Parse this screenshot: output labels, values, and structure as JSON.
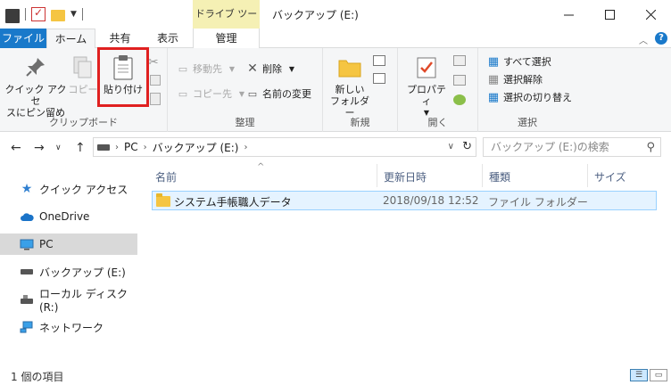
{
  "titlebar": {
    "context_tab": "ドライブ ツール",
    "window_title": "バックアップ (E:)"
  },
  "tabs": {
    "file": "ファイル",
    "home": "ホーム",
    "share": "共有",
    "view": "表示",
    "manage": "管理"
  },
  "ribbon": {
    "clipboard": {
      "pin": "クイック アクセ\nスにピン留め",
      "copy": "コピー",
      "paste": "貼り付け",
      "label": "クリップボード"
    },
    "organize": {
      "move_to": "移動先",
      "copy_to": "コピー先",
      "delete": "削除",
      "rename": "名前の変更",
      "label": "整理"
    },
    "new": {
      "new_folder": "新しい\nフォルダー",
      "label": "新規"
    },
    "open": {
      "properties": "プロパティ",
      "label": "開く"
    },
    "select": {
      "select_all": "すべて選択",
      "select_none": "選択解除",
      "invert": "選択の切り替え",
      "label": "選択"
    }
  },
  "address": {
    "crumbs": [
      "PC",
      "バックアップ (E:)"
    ],
    "search_placeholder": "バックアップ (E:)の検索"
  },
  "nav": {
    "items": [
      {
        "label": "クイック アクセス",
        "icon": "star-icon"
      },
      {
        "label": "OneDrive",
        "icon": "cloud-icon"
      },
      {
        "label": "PC",
        "icon": "monitor-icon",
        "selected": true
      },
      {
        "label": "バックアップ (E:)",
        "icon": "drive-icon"
      },
      {
        "label": "ローカル ディスク (R:)",
        "icon": "drive-icon"
      },
      {
        "label": "ネットワーク",
        "icon": "network-icon"
      }
    ]
  },
  "columns": {
    "name": "名前",
    "date": "更新日時",
    "type": "種類",
    "size": "サイズ"
  },
  "files": [
    {
      "name": "システム手帳職人データ",
      "date": "2018/09/18 12:52",
      "type": "ファイル フォルダー",
      "size": ""
    }
  ],
  "status": {
    "count": "1 個の項目"
  },
  "colors": {
    "file_tab": "#1979ca",
    "context_tab": "#f5f0b4",
    "selection": "#e5f3ff",
    "highlight_box": "#e02020"
  }
}
